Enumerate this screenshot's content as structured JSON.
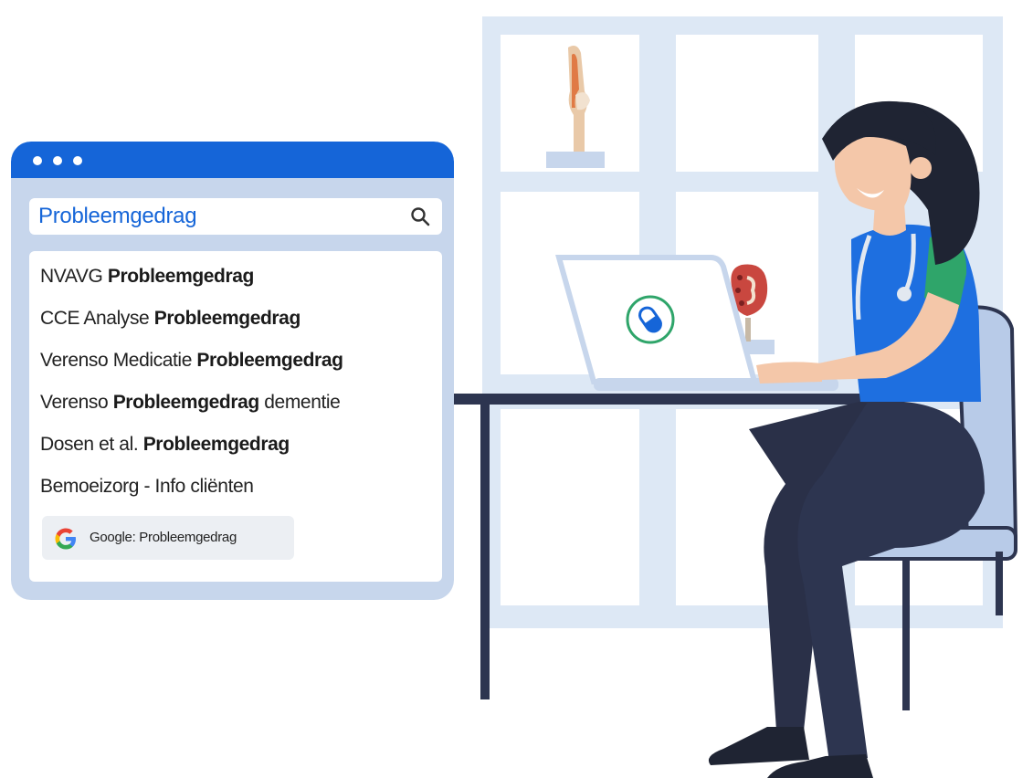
{
  "search": {
    "query": "Probleemgedrag"
  },
  "results": [
    {
      "prefix": "NVAVG ",
      "bold": "Probleemgedrag",
      "suffix": ""
    },
    {
      "prefix": "CCE Analyse ",
      "bold": "Probleemgedrag",
      "suffix": ""
    },
    {
      "prefix": "Verenso Medicatie ",
      "bold": "Probleemgedrag",
      "suffix": ""
    },
    {
      "prefix": "Verenso ",
      "bold": "Probleemgedrag",
      "suffix": " dementie"
    },
    {
      "prefix": "Dosen et al. ",
      "bold": "Probleemgedrag",
      "suffix": ""
    },
    {
      "prefix": "Bemoeizorg - Info cliënten",
      "bold": "",
      "suffix": ""
    }
  ],
  "google": {
    "label": "Google: Probleemgedrag"
  },
  "colors": {
    "brand_blue": "#1565d8",
    "frame": "#c7d6ec",
    "pants": "#2d3550",
    "shirt": "#1e6fe0",
    "sleeve": "#2fa56a",
    "hair": "#1f2433"
  },
  "icons": [
    "search-icon",
    "google-logo-icon",
    "pill-icon"
  ]
}
